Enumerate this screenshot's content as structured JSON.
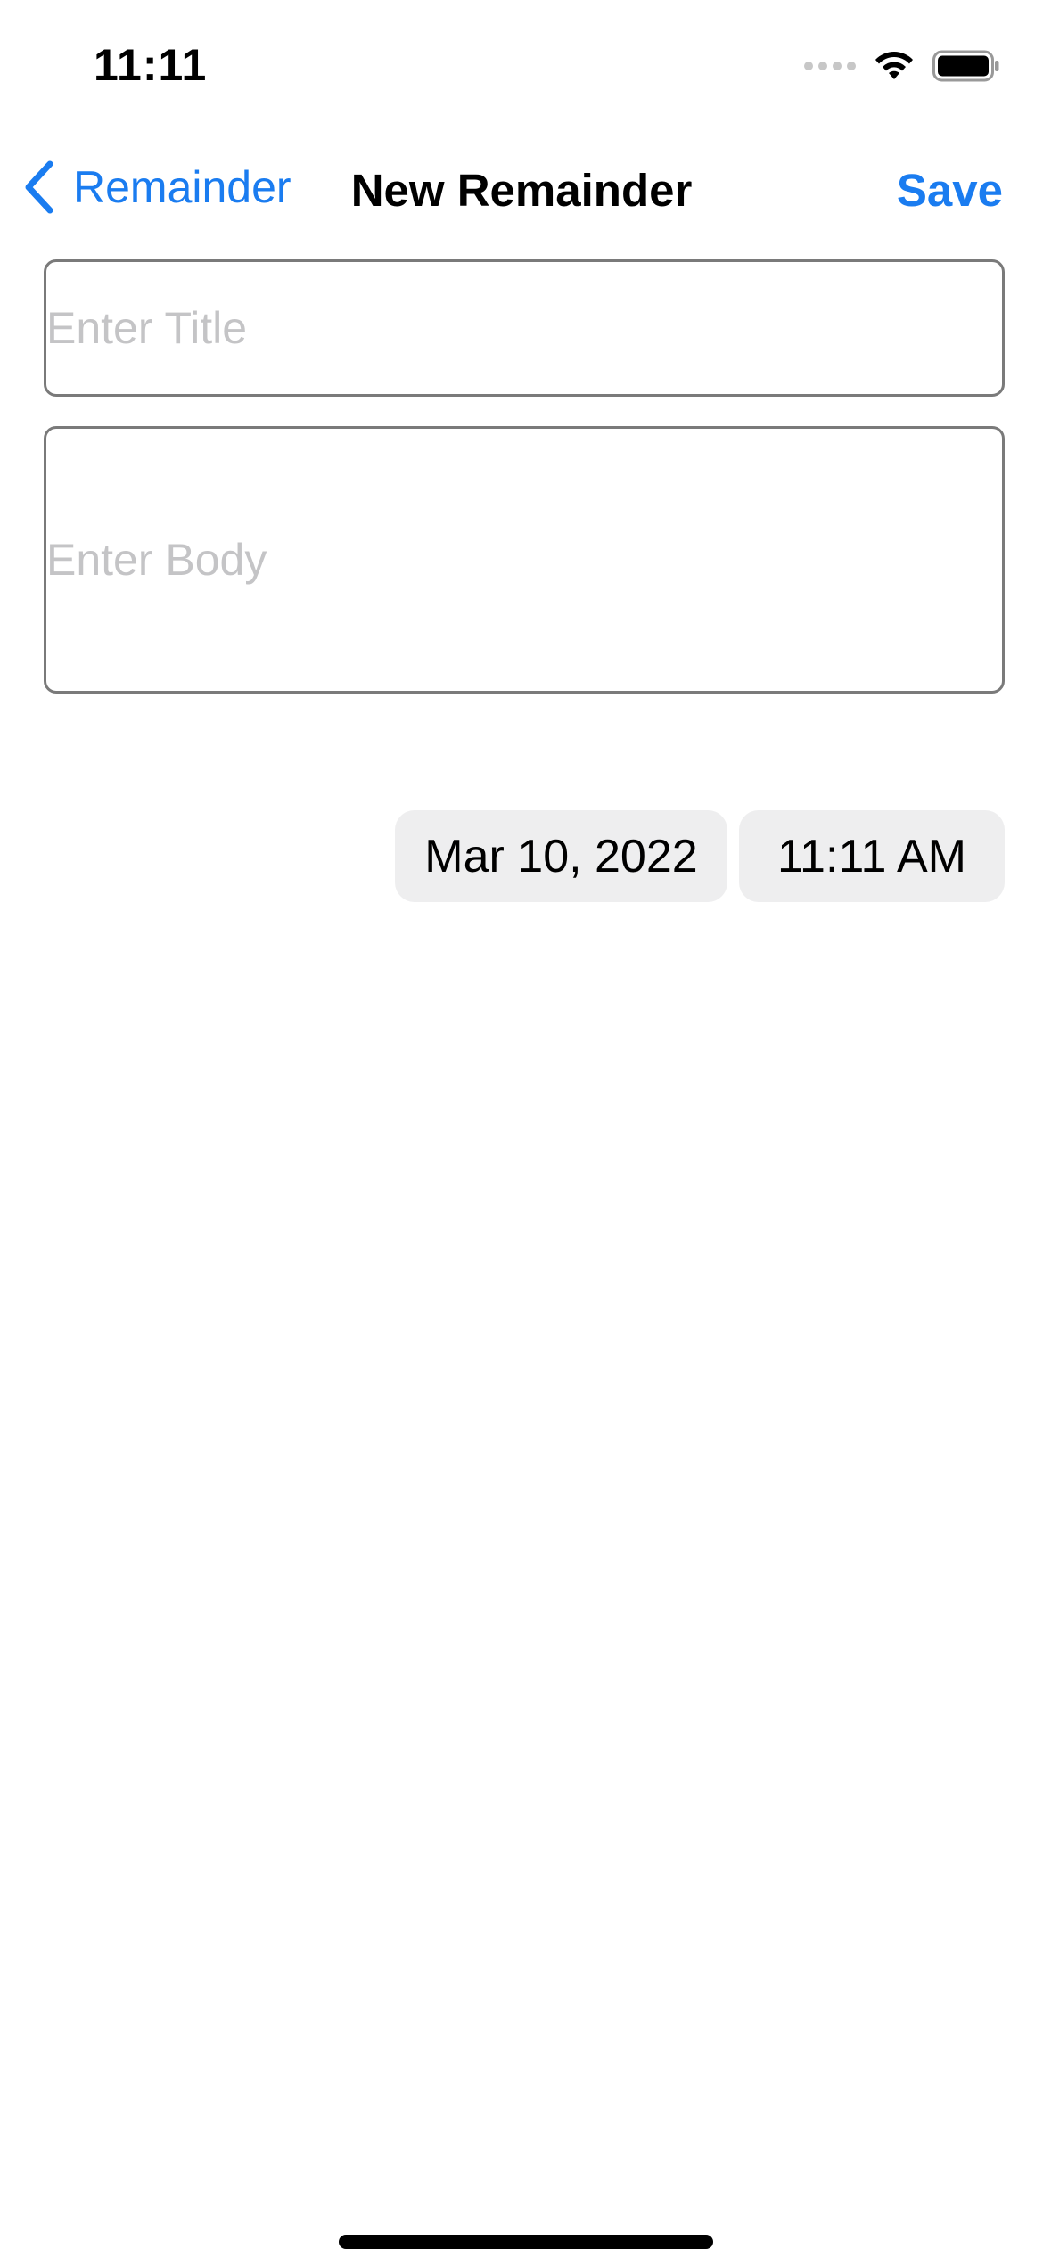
{
  "status_bar": {
    "time": "11:11",
    "icons": [
      "signal-dots-icon",
      "wifi-icon",
      "battery-icon"
    ]
  },
  "nav": {
    "back_label": "Remainder",
    "title": "New Remainder",
    "save_label": "Save",
    "accent_color": "#1a7cf0"
  },
  "form": {
    "title_placeholder": "Enter Title",
    "title_value": "",
    "body_placeholder": "Enter Body",
    "body_value": ""
  },
  "schedule": {
    "date": "Mar 10, 2022",
    "time": "11:11 AM"
  }
}
